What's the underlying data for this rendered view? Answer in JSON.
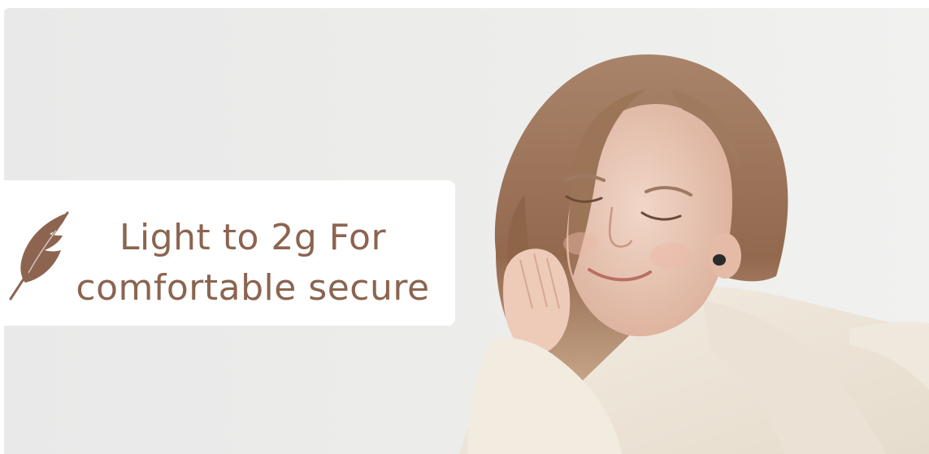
{
  "banner": {
    "headline_line1": "Light to 2g For",
    "headline_line2": "comfortable secure",
    "icon": "feather-icon",
    "colors": {
      "text": "#8b6450",
      "icon": "#8c6450",
      "callout_background": "#ffffff",
      "photo_background": "#ececeb"
    }
  }
}
